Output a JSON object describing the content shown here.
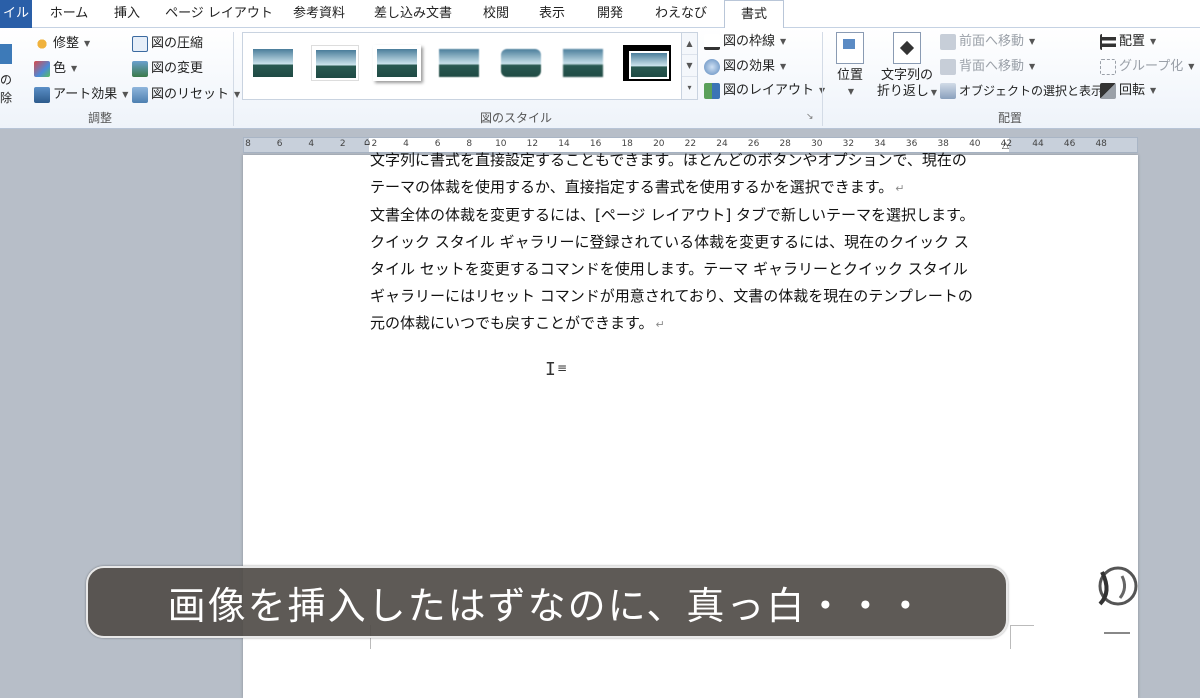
{
  "tabs": [
    {
      "label": "イル",
      "kind": "file"
    },
    {
      "label": "ホーム"
    },
    {
      "label": "挿入"
    },
    {
      "label": "ページ レイアウト"
    },
    {
      "label": "参考資料"
    },
    {
      "label": "差し込み文書"
    },
    {
      "label": "校閲"
    },
    {
      "label": "表示"
    },
    {
      "label": "開発"
    },
    {
      "label": "わえなび"
    },
    {
      "label": "書式",
      "kind": "active"
    }
  ],
  "ribbon": {
    "adjust": {
      "left_cut": [
        "の",
        "除"
      ],
      "corrections": "修整",
      "color": "色",
      "artistic_effects": "アート効果",
      "compress": "図の圧縮",
      "change": "図の変更",
      "reset": "図のリセット",
      "group_label": "調整"
    },
    "styles": {
      "group_label": "図のスタイル",
      "border": "図の枠線",
      "effects": "図の効果",
      "layout": "図のレイアウト"
    },
    "arrange": {
      "position": "位置",
      "wrap_line1": "文字列の",
      "wrap_line2": "折り返し",
      "bring_forward": "前面へ移動",
      "send_backward": "背面へ移動",
      "selection_pane": "オブジェクトの選択と表示",
      "align": "配置",
      "group": "グループ化",
      "rotate": "回転",
      "group_label": "配置"
    }
  },
  "ruler_ticks": [
    "8",
    "6",
    "4",
    "2",
    "2",
    "4",
    "6",
    "8",
    "10",
    "12",
    "14",
    "16",
    "18",
    "20",
    "22",
    "24",
    "26",
    "28",
    "30",
    "32",
    "34",
    "36",
    "38",
    "40",
    "42",
    "44",
    "46",
    "48"
  ],
  "document": {
    "lines": [
      "文字列に書式を直接設定することもできます。ほとんどのボタンやオプションで、現在の",
      "テーマの体裁を使用するか、直接指定する書式を使用するかを選択できます。",
      "文書全体の体裁を変更するには、[ページ レイアウト] タブで新しいテーマを選択します。",
      "クイック スタイル ギャラリーに登録されている体裁を変更するには、現在のクイック ス",
      "タイル セットを変更するコマンドを使用します。テーマ ギャラリーとクイック スタイル",
      "ギャラリーにはリセット コマンドが用意されており、文書の体裁を現在のテンプレートの",
      "元の体裁にいつでも戻すことができます。"
    ],
    "return_mark": "↵"
  },
  "caption": "画像を挿入したはずなのに、真っ白・・・",
  "colors": {
    "file_tab": "#2a5fa8",
    "caption_bg": "#504c48",
    "workspace": "#b7bec8"
  }
}
